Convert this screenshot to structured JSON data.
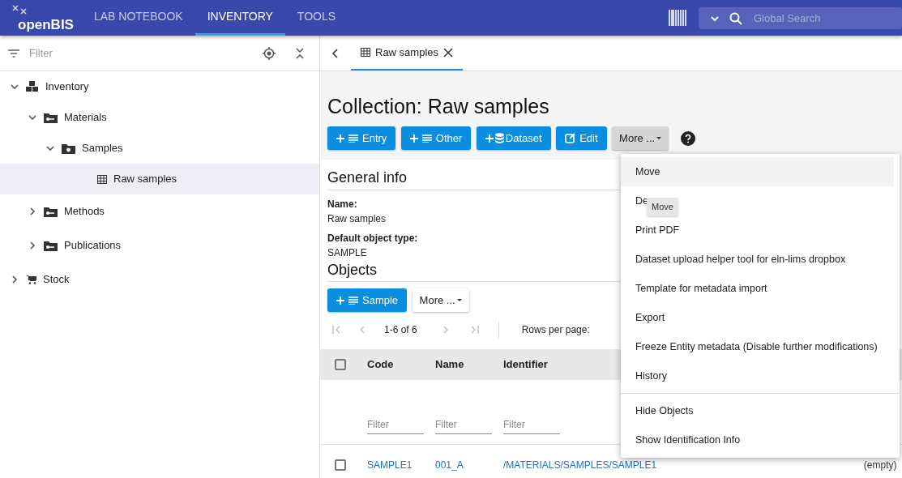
{
  "app": {
    "logo": "openBIS",
    "tabs": [
      {
        "label": "LAB NOTEBOOK",
        "selected": false
      },
      {
        "label": "INVENTORY",
        "selected": true
      },
      {
        "label": "TOOLS",
        "selected": false
      }
    ],
    "search": {
      "placeholder": "Global Search"
    }
  },
  "sidebar": {
    "filter": {
      "placeholder": "Filter"
    },
    "tree": [
      {
        "label": "Inventory",
        "kind": "space",
        "expanded": true,
        "selected": false,
        "children": [
          {
            "label": "Materials",
            "kind": "project",
            "expanded": true,
            "selected": false,
            "children": [
              {
                "label": "Samples",
                "kind": "experiment",
                "expanded": true,
                "selected": false,
                "children": [
                  {
                    "label": "Raw samples",
                    "kind": "collection",
                    "selected": true
                  }
                ]
              }
            ]
          },
          {
            "label": "Methods",
            "kind": "project",
            "expanded": false,
            "selected": false
          },
          {
            "label": "Publications",
            "kind": "project",
            "expanded": false,
            "selected": false
          }
        ]
      },
      {
        "label": "Stock",
        "kind": "store",
        "expanded": false,
        "selected": false
      }
    ]
  },
  "tabs": [
    {
      "label": "Raw samples",
      "selected": true
    }
  ],
  "title": "Collection: Raw samples",
  "toolbar": [
    {
      "label": "Entry",
      "kind": "entry"
    },
    {
      "label": "Other",
      "kind": "entry"
    },
    {
      "label": "Dataset",
      "kind": "dataset"
    },
    {
      "label": "Edit",
      "kind": "edit"
    },
    {
      "label": "More ...",
      "kind": "more"
    }
  ],
  "general_info": {
    "heading": "General info",
    "fields": [
      {
        "label": "Name:",
        "value": "Raw samples"
      },
      {
        "label": "Default object type:",
        "value": "SAMPLE"
      }
    ]
  },
  "objects": {
    "heading": "Objects",
    "buttons": [
      {
        "label": "Sample",
        "kind": "entry"
      },
      {
        "label": "More ...",
        "kind": "more-outline"
      }
    ],
    "pagination": {
      "range": "1-6 of 6",
      "rows_label": "Rows per page:"
    },
    "table": {
      "all_checked": false,
      "columns": [
        "Code",
        "Name",
        "Identifier"
      ],
      "filters": [
        {
          "placeholder": "Filter"
        },
        {
          "placeholder": "Filter"
        },
        {
          "placeholder": "Filter"
        }
      ],
      "rows": [
        {
          "checked": false,
          "cells": [
            "SAMPLE1",
            "001_A",
            "/MATERIALS/SAMPLES/SAMPLE1",
            "(empty)"
          ]
        }
      ]
    }
  },
  "menu": {
    "tooltip": "Move",
    "items": [
      {
        "label": "Move",
        "selected": true,
        "divider_before": false
      },
      {
        "label": "De",
        "selected": false,
        "divider_before": false
      },
      {
        "label": "Print PDF",
        "selected": false,
        "divider_before": false
      },
      {
        "label": "Dataset upload helper tool for eln-lims dropbox",
        "selected": false,
        "divider_before": false
      },
      {
        "label": "Template for metadata import",
        "selected": false,
        "divider_before": false
      },
      {
        "label": "Export",
        "selected": false,
        "divider_before": false
      },
      {
        "label": "Freeze Entity metadata (Disable further modifications)",
        "selected": false,
        "divider_before": false
      },
      {
        "label": "History",
        "selected": false,
        "divider_before": false
      },
      {
        "label": "Hide Objects",
        "selected": false,
        "divider_before": true
      },
      {
        "label": "Show Identification Info",
        "selected": false,
        "divider_before": false
      }
    ]
  }
}
